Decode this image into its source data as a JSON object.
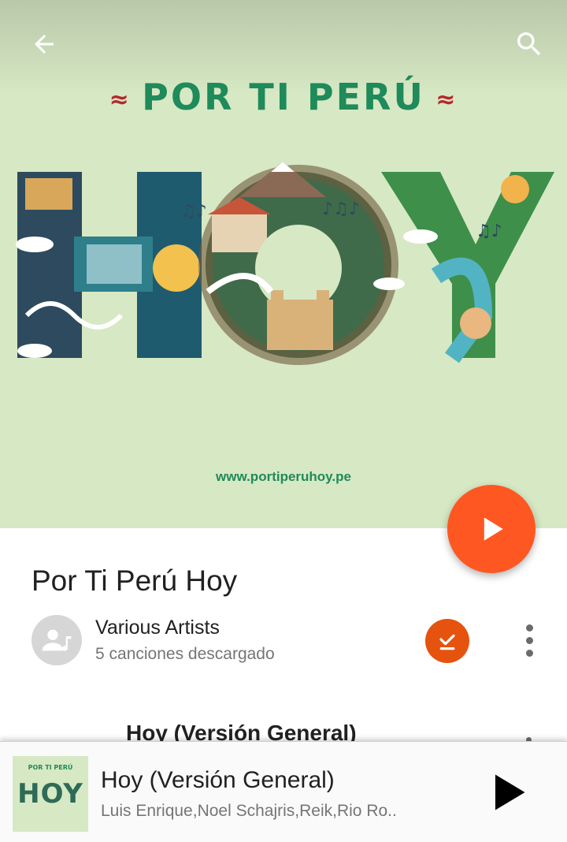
{
  "header": {
    "back_icon": "arrow-back-icon",
    "search_icon": "search-icon"
  },
  "album_art": {
    "heading": "POR TI PERÚ",
    "main_word": "HOY",
    "url": "www.portiperuhoy.pe",
    "background_color": "#d7e8c4",
    "accent_color": "#1f8a5a",
    "flag_color": "#b5272d"
  },
  "fab": {
    "icon": "play-icon",
    "color": "#ff5722"
  },
  "album": {
    "title": "Por Ti Perú Hoy",
    "artist": "Various Artists",
    "download_status": "5 canciones descargado",
    "download_badge_icon": "download-check-icon",
    "download_badge_color": "#e6530f",
    "more_icon": "more-vert-icon"
  },
  "tracks": [
    {
      "title": "Hoy (Versión General)"
    }
  ],
  "mini_player": {
    "art_heading": "POR TI PERÚ",
    "art_word": "HOY",
    "title": "Hoy (Versión General)",
    "artist": "Luis Enrique,Noel Schajris,Reik,Rio Ro..",
    "play_icon": "play-icon"
  }
}
